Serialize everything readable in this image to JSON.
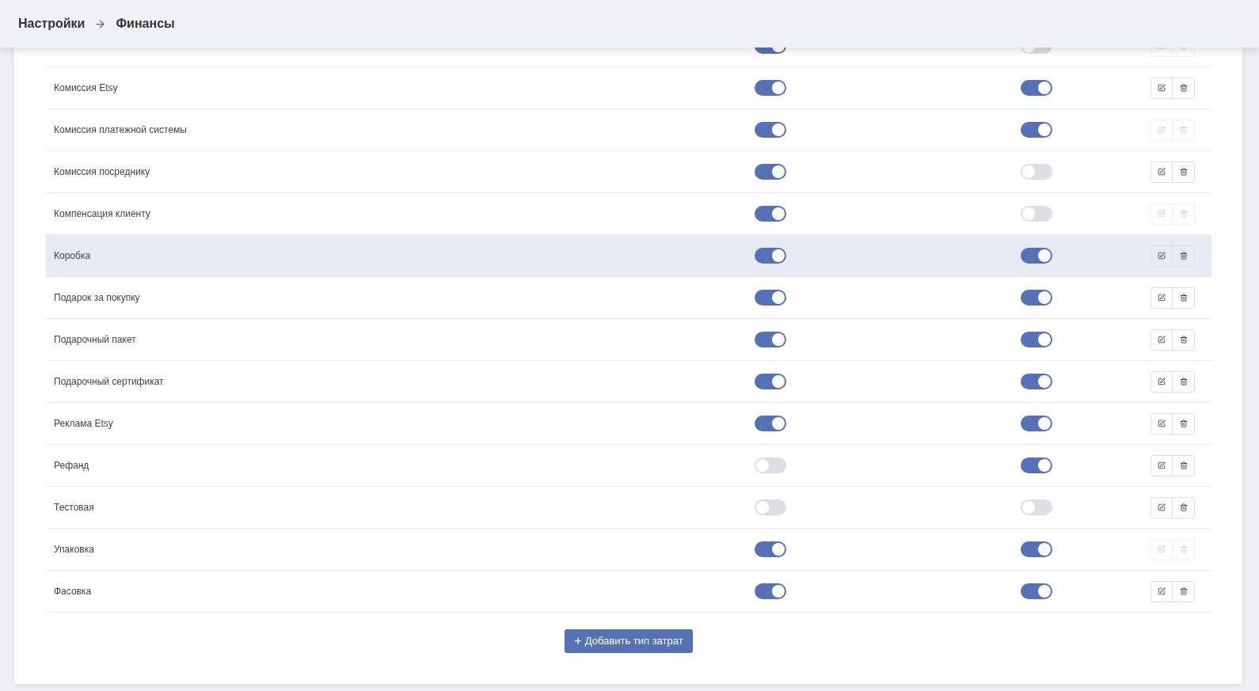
{
  "breadcrumb": [
    "Настройки",
    "Финансы"
  ],
  "rows": [
    {
      "col1_on": true,
      "col2_on": false,
      "actions_disabled": true,
      "highlighted": false
    },
    {
      "name": "Комиссия Etsy",
      "col1_on": true,
      "col2_on": true,
      "actions_disabled": false,
      "highlighted": false
    },
    {
      "name": "Комиссия платежной системы",
      "col1_on": true,
      "col2_on": true,
      "actions_disabled": true,
      "highlighted": false
    },
    {
      "name": "Комиссия посреднику",
      "col1_on": true,
      "col2_on": false,
      "actions_disabled": false,
      "highlighted": false
    },
    {
      "name": "Компенсация клиенту",
      "col1_on": true,
      "col2_on": false,
      "actions_disabled": true,
      "highlighted": false
    },
    {
      "name": "Коробка",
      "col1_on": true,
      "col2_on": true,
      "actions_disabled": false,
      "highlighted": true
    },
    {
      "name": "Подарок за покупку",
      "col1_on": true,
      "col2_on": true,
      "actions_disabled": false,
      "highlighted": false
    },
    {
      "name": "Подарочный пакет",
      "col1_on": true,
      "col2_on": true,
      "actions_disabled": false,
      "highlighted": false
    },
    {
      "name": "Подарочный сертификат",
      "col1_on": true,
      "col2_on": true,
      "actions_disabled": false,
      "highlighted": false
    },
    {
      "name": "Реклама Etsy",
      "col1_on": true,
      "col2_on": true,
      "actions_disabled": false,
      "highlighted": false
    },
    {
      "name": "Рефанд",
      "col1_on": false,
      "col2_on": true,
      "actions_disabled": false,
      "highlighted": false
    },
    {
      "name": "Тестовая",
      "col1_on": false,
      "col2_on": false,
      "actions_disabled": false,
      "highlighted": false
    },
    {
      "name": "Упаковка",
      "col1_on": true,
      "col2_on": true,
      "actions_disabled": true,
      "highlighted": false
    },
    {
      "name": "Фасовка",
      "col1_on": true,
      "col2_on": true,
      "actions_disabled": false,
      "highlighted": false
    }
  ],
  "add_button": {
    "icon": "+",
    "label": "Добавить тип затрат"
  }
}
